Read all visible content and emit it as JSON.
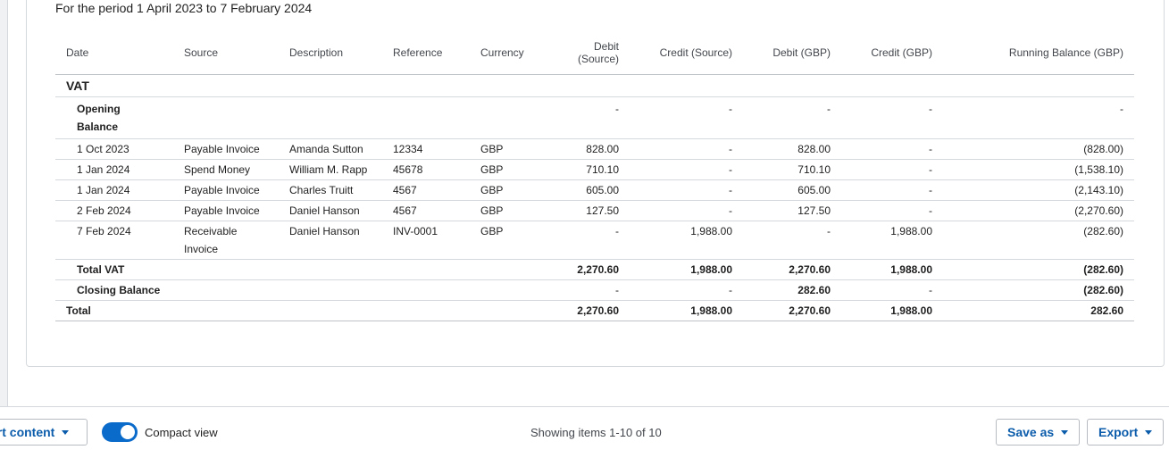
{
  "report": {
    "period": "For the period 1 April 2023 to 7 February 2024",
    "columns": [
      "Date",
      "Source",
      "Description",
      "Reference",
      "Currency",
      "Debit (Source)",
      "Credit (Source)",
      "Debit (GBP)",
      "Credit (GBP)",
      "Running Balance (GBP)"
    ],
    "section_name": "VAT",
    "opening_balance": {
      "label": "Opening Balance",
      "debit_source": "-",
      "credit_source": "-",
      "debit_gbp": "-",
      "credit_gbp": "-",
      "running_balance": "-"
    },
    "rows": [
      {
        "date": "1 Oct 2023",
        "source": "Payable Invoice",
        "description": "Amanda Sutton",
        "reference": "12334",
        "currency": "GBP",
        "debit_source": "828.00",
        "credit_source": "-",
        "debit_gbp": "828.00",
        "credit_gbp": "-",
        "running_balance": "(828.00)"
      },
      {
        "date": "1 Jan 2024",
        "source": "Spend Money",
        "description": "William M. Rapp",
        "reference": "45678",
        "currency": "GBP",
        "debit_source": "710.10",
        "credit_source": "-",
        "debit_gbp": "710.10",
        "credit_gbp": "-",
        "running_balance": "(1,538.10)"
      },
      {
        "date": "1 Jan 2024",
        "source": "Payable Invoice",
        "description": "Charles Truitt",
        "reference": "4567",
        "currency": "GBP",
        "debit_source": "605.00",
        "credit_source": "-",
        "debit_gbp": "605.00",
        "credit_gbp": "-",
        "running_balance": "(2,143.10)"
      },
      {
        "date": "2 Feb 2024",
        "source": "Payable Invoice",
        "description": "Daniel Hanson",
        "reference": "4567",
        "currency": "GBP",
        "debit_source": "127.50",
        "credit_source": "-",
        "debit_gbp": "127.50",
        "credit_gbp": "-",
        "running_balance": "(2,270.60)"
      },
      {
        "date": "7 Feb 2024",
        "source": "Receivable Invoice",
        "description": "Daniel Hanson",
        "reference": "INV-0001",
        "currency": "GBP",
        "debit_source": "-",
        "credit_source": "1,988.00",
        "debit_gbp": "-",
        "credit_gbp": "1,988.00",
        "running_balance": "(282.60)"
      }
    ],
    "total_section": {
      "label": "Total VAT",
      "debit_source": "2,270.60",
      "credit_source": "1,988.00",
      "debit_gbp": "2,270.60",
      "credit_gbp": "1,988.00",
      "running_balance": "(282.60)"
    },
    "closing_balance": {
      "label": "Closing Balance",
      "debit_source": "-",
      "credit_source": "-",
      "debit_gbp": "282.60",
      "credit_gbp": "-",
      "running_balance": "(282.60)"
    },
    "grand_total": {
      "label": "Total",
      "debit_source": "2,270.60",
      "credit_source": "1,988.00",
      "debit_gbp": "2,270.60",
      "credit_gbp": "1,988.00",
      "running_balance": "282.60"
    }
  },
  "footer": {
    "insert_content_label": "ert content",
    "compact_view_label": "Compact view",
    "compact_view_on": true,
    "showing_items": "Showing items 1-10 of 10",
    "save_as_label": "Save as",
    "export_label": "Export"
  },
  "colors": {
    "accent": "#0b6bcb",
    "link": "#0b5cab",
    "border": "#d5d8dc"
  },
  "icons": {
    "dropdown": "chevron-down-icon"
  }
}
